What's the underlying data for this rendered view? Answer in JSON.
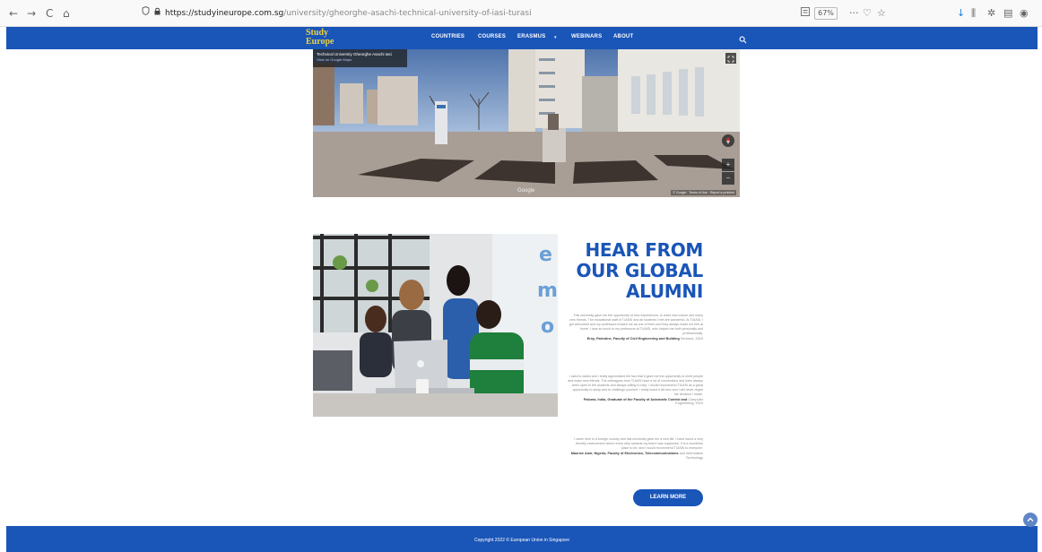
{
  "browser": {
    "back": "←",
    "forward": "→",
    "reload": "C",
    "home": "⌂",
    "url_host": "https://studyineurope.com.sg",
    "url_path": "/university/gheorghe-asachi-technical-university-of-iasi-turasi",
    "zoom": "67%",
    "more": "···",
    "pocket": "♡",
    "star": "☆",
    "download": "↓",
    "library": "⫼",
    "extension": "✲",
    "sidebar": "▤",
    "account": "◉"
  },
  "header": {
    "logo_line1": "Study",
    "logo_line2": "Europe",
    "nav": [
      "COUNTRIES",
      "COURSES",
      "ERASMUS",
      "WEBINARS",
      "ABOUT"
    ],
    "dropdown_mark": "▾",
    "colors": {
      "primary": "#1a55b8",
      "logo": "#f0d23a"
    }
  },
  "streetview": {
    "place_name": "Technical University Gheorghe Asachi Iasi",
    "place_sub": "View on Google Maps",
    "google": "Google",
    "terms": "© Google · Terms of Use · Report a problem",
    "zoom_in": "+",
    "zoom_out": "−"
  },
  "alumni": {
    "title_line1": "HEAR FROM",
    "title_line2": "OUR GLOBAL",
    "title_line3": "ALUMNI",
    "testimonials": [
      {
        "text": "This university gave me the opportunity of new experiences, to meet new culture and many new friends. The educational staff of TUIASI and all students I met are wonderful. At TUIASI, I got welcomed and my professors treated me as one of them and they always made me feel at home. I owe so much to my professors at TUIASI, who helped me both personally and professionally.",
        "author": "Erny, Palestine, Faculty of Civil Engineering and Building",
        "date": "Services, 2019"
      },
      {
        "text": "I used to assist and I really appreciated the fact that it gave me the opportunity to meet people and make new friends. The colleagues from TUIASI have a lot of connections and have always been open to the students and always willing to help. I would recommend TUIASI as a great opportunity to study and to challenge yourself. I really loved it all here and I will never regret the decision I made.",
        "author": "Paloma, India, Graduate of the Faculty of Automatic Control and",
        "date": "Computer Engineering, 2019"
      },
      {
        "text": "I came here in a foreign country and this university gave me a new life. I have found a very friendly environment where every step towards my future was supported. It is a wonderful place to be, and I would recommend TUIASI to everyone.",
        "author": "Maurice Amir, Nigeria, Faculty of Electronics, Telecommunications",
        "date": "and Information Technology"
      }
    ],
    "button": "LEARN MORE"
  },
  "footer": {
    "copyright": "Copyright 2022 © European Union in Singapore"
  }
}
